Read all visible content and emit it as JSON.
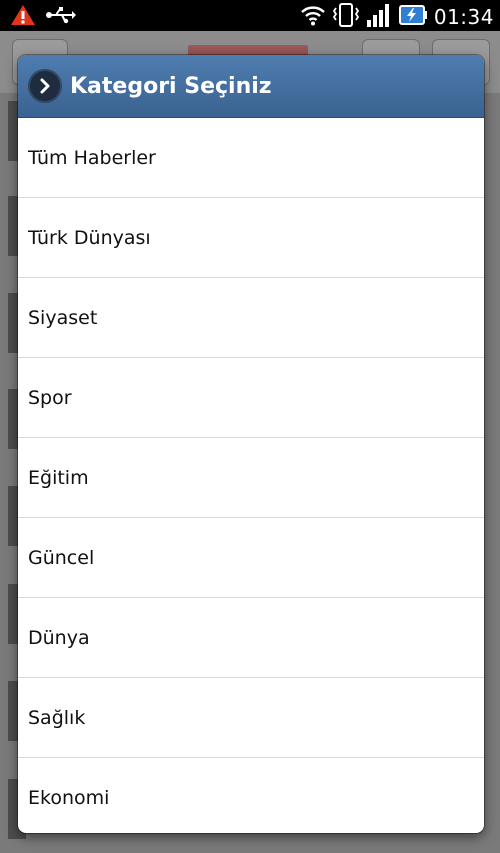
{
  "status_bar": {
    "time": "01:34",
    "icons": [
      "warning-icon",
      "usb-icon",
      "wifi-icon",
      "vibrate-icon",
      "signal-icon",
      "battery-charging-icon"
    ]
  },
  "dialog": {
    "title": "Kategori Seçiniz",
    "items": [
      {
        "label": "Tüm Haberler"
      },
      {
        "label": "Türk Dünyası"
      },
      {
        "label": "Siyaset"
      },
      {
        "label": "Spor"
      },
      {
        "label": "Eğitim"
      },
      {
        "label": "Güncel"
      },
      {
        "label": "Dünya"
      },
      {
        "label": "Sağlık"
      },
      {
        "label": "Ekonomi"
      }
    ]
  },
  "colors": {
    "header_top": "#4f7db0",
    "header_bottom": "#3a6291",
    "warning": "#e0341c",
    "battery_charging": "#2f7fd6"
  }
}
